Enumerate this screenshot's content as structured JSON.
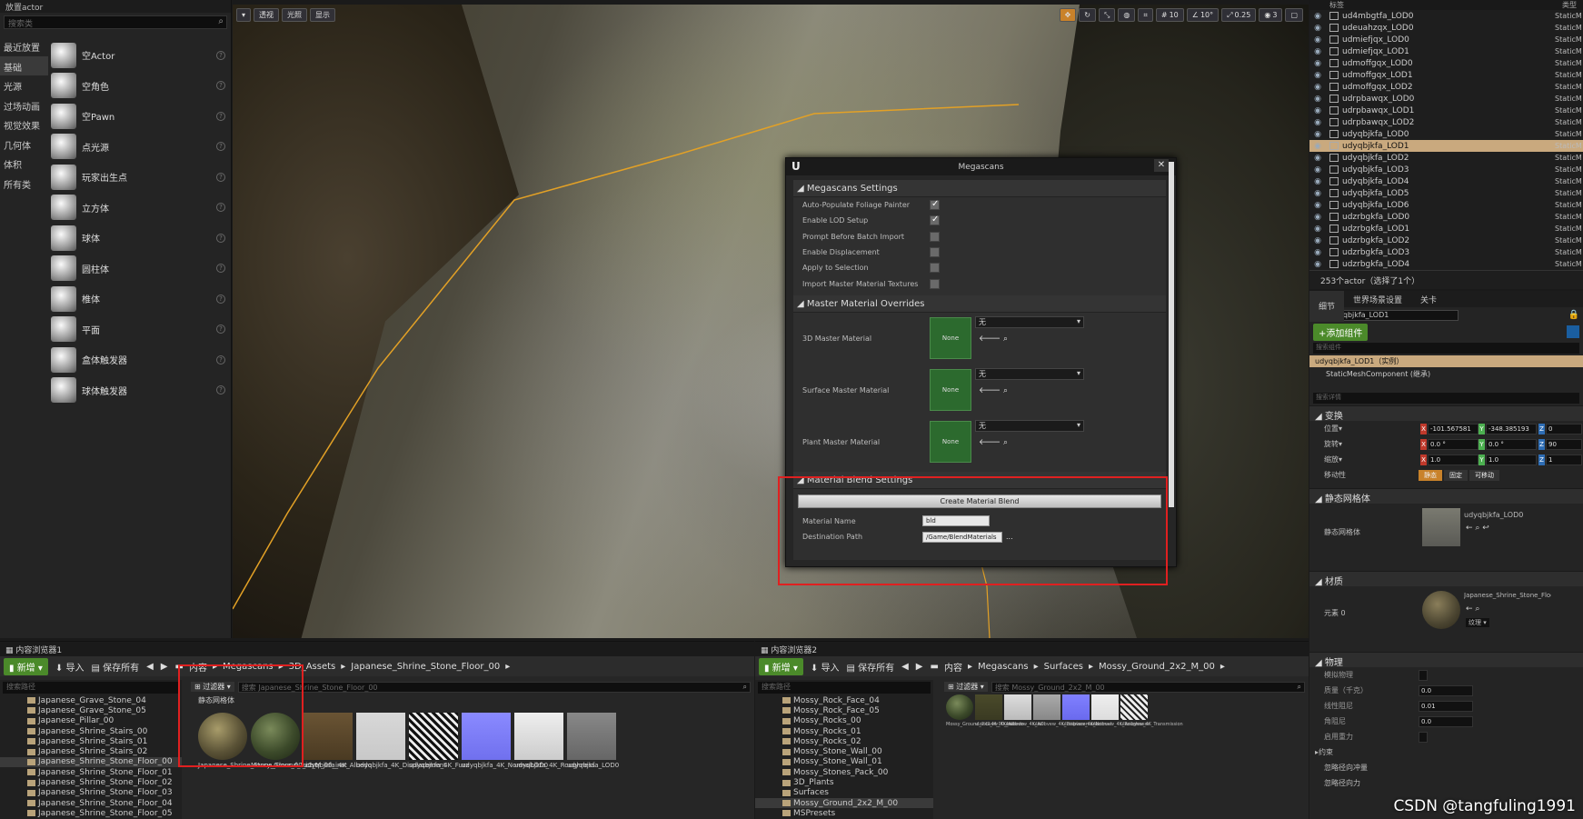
{
  "place_actor": {
    "title": "放置actor",
    "search_placeholder": "搜索类",
    "categories": [
      "最近放置",
      "基础",
      "光源",
      "过场动画",
      "视觉效果",
      "几何体",
      "体积",
      "所有类"
    ],
    "items": [
      "空Actor",
      "空角色",
      "空Pawn",
      "点光源",
      "玩家出生点",
      "立方体",
      "球体",
      "圆柱体",
      "椎体",
      "平面",
      "盒体触发器",
      "球体触发器"
    ]
  },
  "viewport": {
    "perspective": "透视",
    "lit": "光照",
    "show": "显示",
    "grid_snap": "10",
    "rot_snap": "10°",
    "scale_snap": "0.25",
    "camera_speed": "3"
  },
  "megascans": {
    "title": "Megascans",
    "settings_header": "Megascans Settings",
    "settings": [
      {
        "label": "Auto-Populate Foliage Painter",
        "checked": true
      },
      {
        "label": "Enable LOD Setup",
        "checked": true
      },
      {
        "label": "Prompt Before Batch Import",
        "checked": false
      },
      {
        "label": "Enable Displacement",
        "checked": false
      },
      {
        "label": "Apply to Selection",
        "checked": false
      },
      {
        "label": "Import Master Material Textures",
        "checked": false
      }
    ],
    "overrides_header": "Master Material Overrides",
    "overrides": [
      {
        "label": "3D Master Material",
        "thumb": "None",
        "value": "无"
      },
      {
        "label": "Surface Master Material",
        "thumb": "None",
        "value": "无"
      },
      {
        "label": "Plant Master Material",
        "thumb": "None",
        "value": "无"
      }
    ],
    "blend_header": "Material Blend Settings",
    "blend_button": "Create Material Blend",
    "material_name_label": "Material Name",
    "material_name": "bld",
    "dest_label": "Destination Path",
    "dest_path": "/Game/BlendMaterials",
    "dest_more": "..."
  },
  "outliner": {
    "col_label": "标签",
    "col_type": "类型",
    "rows": [
      "ud4mbgtfa_LOD0",
      "udeuahzqx_LOD0",
      "udmiefjqx_LOD0",
      "udmiefjqx_LOD1",
      "udmoffgqx_LOD0",
      "udmoffgqx_LOD1",
      "udmoffgqx_LOD2",
      "udrpbawqx_LOD0",
      "udrpbawqx_LOD1",
      "udrpbawqx_LOD2",
      "udyqbjkfa_LOD0",
      "udyqbjkfa_LOD1",
      "udyqbjkfa_LOD2",
      "udyqbjkfa_LOD3",
      "udyqbjkfa_LOD4",
      "udyqbjkfa_LOD5",
      "udyqbjkfa_LOD6",
      "udzrbgkfa_LOD0",
      "udzrbgkfa_LOD1",
      "udzrbgkfa_LOD2",
      "udzrbgkfa_LOD3",
      "udzrbgkfa_LOD4"
    ],
    "type": "StaticM",
    "selected_index": 11,
    "footer": "253个actor（选择了1个）"
  },
  "details": {
    "tabs": [
      "细节",
      "世界场景设置",
      "关卡"
    ],
    "name": "udyqbjkfa_LOD1",
    "add_component": "+添加组件",
    "search_comp": "搜索组件",
    "component": "udyqbjkfa_LOD1（实例）",
    "sub_component": "StaticMeshComponent (继承)",
    "search_detail": "搜索详情",
    "transform_header": "变换",
    "location_label": "位置",
    "rotation_label": "旋转",
    "scale_label": "缩放",
    "loc": [
      "-101.567581",
      "-348.385193",
      "0"
    ],
    "rot": [
      "0.0 °",
      "0.0 °",
      "90"
    ],
    "scl": [
      "1.0",
      "1.0",
      "1"
    ],
    "mobility_label": "移动性",
    "mobility": [
      "静态",
      "固定",
      "可移动"
    ],
    "staticmesh_header": "静态网格体",
    "staticmesh_label": "静态网格体",
    "staticmesh_value": "udyqbjkfa_LOD0",
    "material_header": "材质",
    "element_label": "元素 0",
    "material_value": "Japanese_Shrine_Stone_Floor",
    "texture": "纹理",
    "physics_header": "物理",
    "physics_props": [
      {
        "label": "模拟物理",
        "value": ""
      },
      {
        "label": "质量（千克）",
        "value": "0.0"
      },
      {
        "label": "线性阻尼",
        "value": "0.01"
      },
      {
        "label": "角阻尼",
        "value": "0.0"
      },
      {
        "label": "启用重力",
        "value": ""
      }
    ],
    "constraints": "约束",
    "more": "忽略径向冲量",
    "more2": "忽略径向力"
  },
  "cb1": {
    "tab": "内容浏览器1",
    "new": "新增",
    "import": "导入",
    "save_all": "保存所有",
    "crumbs": [
      "内容",
      "Megascans",
      "3D_Assets",
      "Japanese_Shrine_Stone_Floor_00"
    ],
    "search": "搜索路径",
    "filter": "过滤器",
    "asset_search": "搜索 Japanese_Shrine_Stone_Floor_00",
    "section": "静态网格体",
    "tree": [
      "Japanese_Grave_Stone_04",
      "Japanese_Grave_Stone_05",
      "Japanese_Pillar_00",
      "Japanese_Shrine_Stairs_00",
      "Japanese_Shrine_Stairs_01",
      "Japanese_Shrine_Stairs_02",
      "Japanese_Shrine_Stone_Floor_00",
      "Japanese_Shrine_Stone_Floor_01",
      "Japanese_Shrine_Stone_Floor_02",
      "Japanese_Shrine_Stone_Floor_03",
      "Japanese_Shrine_Stone_Floor_04",
      "Japanese_Shrine_Stone_Floor_05"
    ],
    "tree_selected": 6,
    "assets": [
      "Japanese_Shrine_Stone_Floor_00_inst",
      "Mossy_Ground_2x2_M_00_inst",
      "udyqbjkfa_4K_Albedo",
      "udyqbjkfa_4K_Displacement",
      "udyqbjkfa_4K_Fuzz",
      "udyqbjkfa_4K_NormalLOD0",
      "udyqbjkfa_4K_Roughness",
      "udyqbjkfa_LOD0"
    ]
  },
  "cb2": {
    "tab": "内容浏览器2",
    "new": "新增",
    "import": "导入",
    "save_all": "保存所有",
    "crumbs": [
      "内容",
      "Megascans",
      "Surfaces",
      "Mossy_Ground_2x2_M_00"
    ],
    "search": "搜索路径",
    "filter": "过滤器",
    "asset_search": "搜索 Mossy_Ground_2x2_M_00",
    "tree": [
      "Mossy_Rock_Face_04",
      "Mossy_Rock_Face_05",
      "Mossy_Rocks_00",
      "Mossy_Rocks_01",
      "Mossy_Rocks_02",
      "Mossy_Stone_Wall_00",
      "Mossy_Stone_Wall_01",
      "Mossy_Stones_Pack_00",
      "3D_Plants",
      "Surfaces",
      "Mossy_Ground_2x2_M_00",
      "MSPresets"
    ],
    "tree_selected": 10,
    "assets": [
      "Mossy_Ground_2x2_M_00_inst",
      "ulzeibvew_4K_Albedo",
      "ulzeibvew_4K_AO",
      "ulzeibvew_4K_Displacement",
      "ulzeibvew_4K_Normal",
      "ulzeibvew_4K_Roughness",
      "ulzeibvew_4K_Transmission"
    ]
  },
  "watermark": "CSDN @tangfuling1991"
}
